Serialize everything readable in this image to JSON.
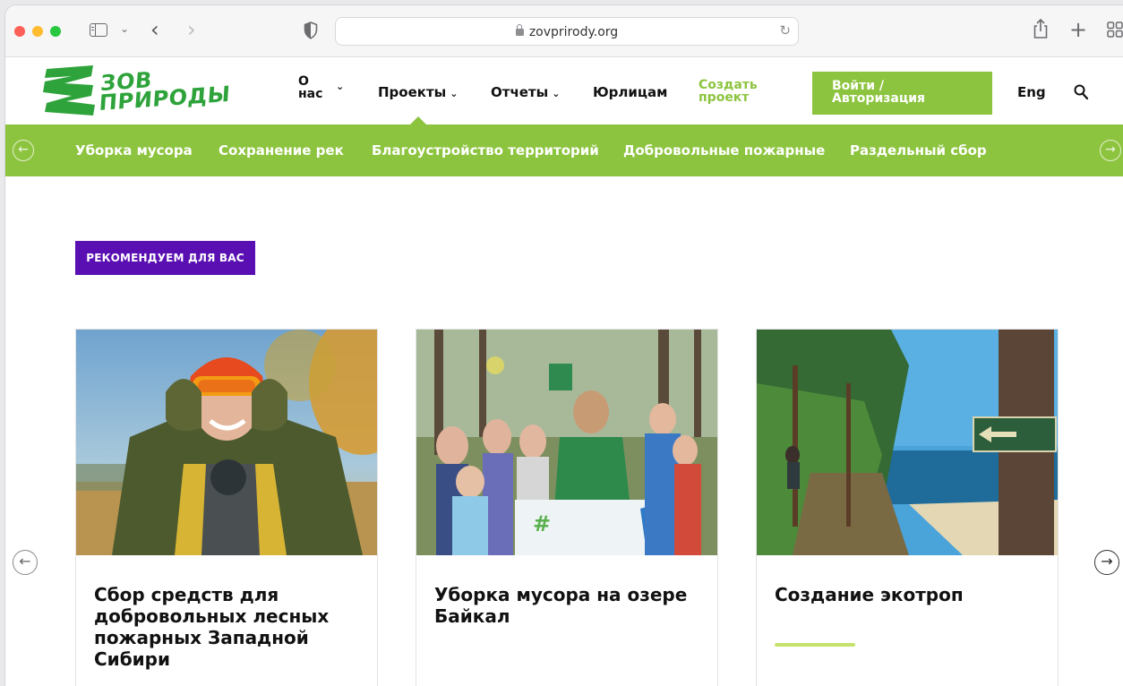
{
  "browser": {
    "url": "zovprirody.org"
  },
  "site": {
    "logo": {
      "line1": "ЗОВ",
      "line2": "ПРИРОДЫ"
    },
    "nav": {
      "about_line1": "О",
      "about_line2": "нас",
      "projects": "Проекты",
      "reports": "Отчеты",
      "legal": "Юрлицам",
      "create_line1": "Создать",
      "create_line2": "проект",
      "login_line1": "Войти /",
      "login_line2": "Авторизация",
      "lang": "Eng"
    },
    "categories": [
      "Уборка мусора",
      "Сохранение рек",
      "Благоустройство территорий",
      "Добровольные пожарные",
      "Раздельный сбор"
    ],
    "recommend_badge": "РЕКОМЕНДУЕМ ДЛЯ ВАС",
    "cards": [
      {
        "title": "Сбор средств для добровольных лесных пожарных Западной Сибири"
      },
      {
        "title": "Уборка мусора на озере Байкал"
      },
      {
        "title": "Создание экотроп"
      }
    ],
    "colors": {
      "brand_green": "#8dc43f",
      "logo_green": "#2fa33b",
      "badge_purple": "#5a0fb2"
    }
  }
}
